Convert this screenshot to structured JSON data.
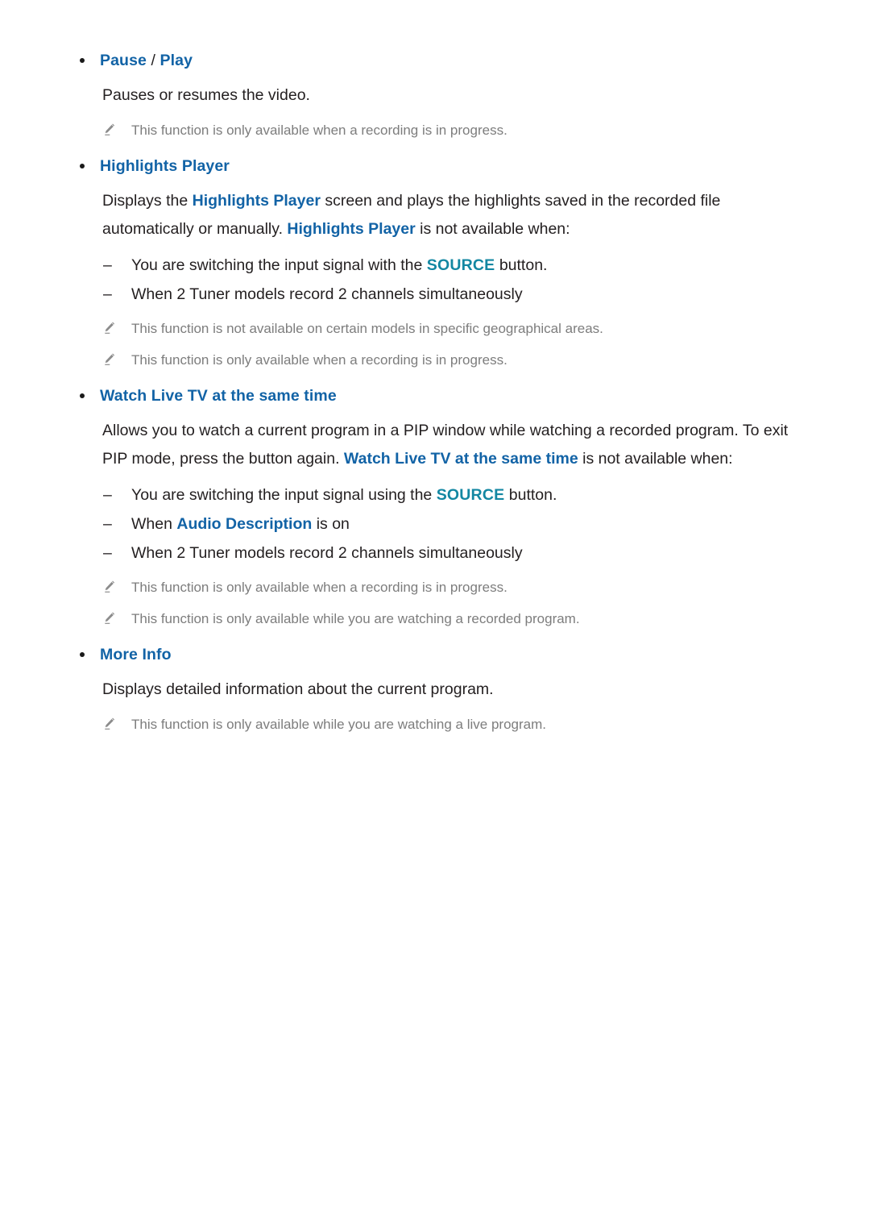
{
  "document": {
    "icons": {
      "note": "pencil-icon",
      "bullet": "bullet-dot-icon",
      "dash": "dash-icon"
    },
    "colors": {
      "heading_blue": "#1263a6",
      "source_teal": "#1387a2",
      "body_text": "#231f20",
      "note_text": "#7d7d7d",
      "background": "#ffffff"
    },
    "sections": [
      {
        "id": "pause-play",
        "title_parts": [
          "Pause",
          " / ",
          "Play"
        ],
        "title_plain": "Pause / Play",
        "body": "Pauses or resumes the video.",
        "notes": [
          "This function is only available when a recording is in progress."
        ]
      },
      {
        "id": "highlights-player",
        "title_plain": "Highlights Player",
        "body_line1_a": "Displays the ",
        "body_line1_kw": "Highlights Player",
        "body_line1_b": " screen and plays the highlights saved in the recorded file automatically or manually. ",
        "body_line2_kw": "Highlights Player",
        "body_line2_b": " is not available when:",
        "dashes": [
          {
            "pre": "You are switching the input signal with the ",
            "kw": "SOURCE",
            "post": " button."
          },
          {
            "pre": "When 2 Tuner models record 2 channels simultaneously",
            "kw": "",
            "post": ""
          }
        ],
        "notes": [
          "This function is not available on certain models in specific geographical areas.",
          "This function is only available when a recording is in progress."
        ]
      },
      {
        "id": "watch-live-tv",
        "title_plain": "Watch Live TV at the same time",
        "body_line1_a": "Allows you to watch a current program in a PIP window while watching a recorded program. To exit PIP mode, press the button again. ",
        "body_line1_kw": "Watch Live TV at the same time",
        "body_line1_b": " is not available when:",
        "dashes": [
          {
            "pre": "You are switching the input signal using the ",
            "kw": "SOURCE",
            "post": " button."
          },
          {
            "pre": "When ",
            "kw": "Audio Description",
            "post": " is on"
          },
          {
            "pre": "When 2 Tuner models record 2 channels simultaneously",
            "kw": "",
            "post": ""
          }
        ],
        "notes": [
          "This function is only available when a recording is in progress.",
          "This function is only available while you are watching a recorded program."
        ]
      },
      {
        "id": "more-info",
        "title_plain": "More Info",
        "body": "Displays detailed information about the current program.",
        "notes": [
          "This function is only available while you are watching a live program."
        ]
      }
    ]
  }
}
